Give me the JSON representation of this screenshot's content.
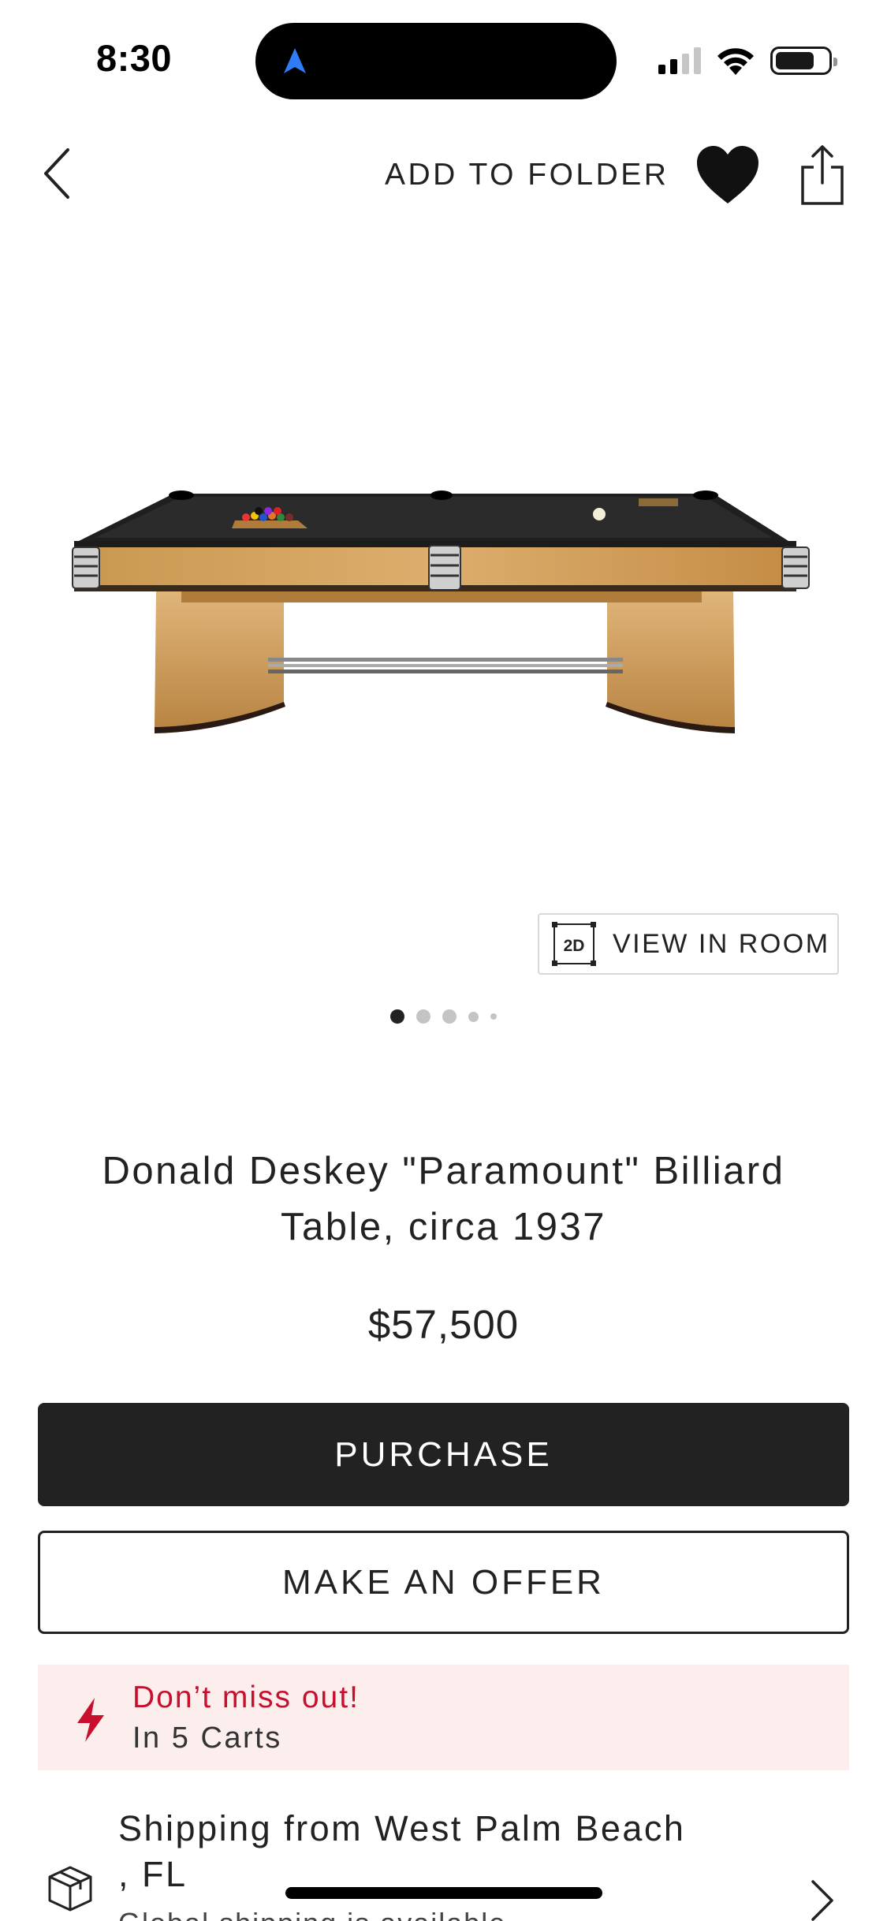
{
  "status_bar": {
    "time": "8:30"
  },
  "nav": {
    "add_to_folder": "ADD TO FOLDER"
  },
  "gallery": {
    "view_in_room_badge": "2D",
    "view_in_room_label": "VIEW IN ROOM",
    "page_count": 5,
    "active_index": 0
  },
  "product": {
    "title": "Donald Deskey \"Paramount\" Billiard Table, circa 1937",
    "price": "$57,500"
  },
  "actions": {
    "purchase_label": "PURCHASE",
    "offer_label": "MAKE AN OFFER"
  },
  "alert": {
    "title": "Don’t miss out!",
    "subtitle": "In 5 Carts",
    "accent_color": "#c8102e"
  },
  "shipping": {
    "title": "Shipping from West Palm Beach , FL",
    "subtitle": "Global shipping is available"
  },
  "icons": {
    "back": "chevron-left-icon",
    "favorite": "heart-icon",
    "share": "share-icon",
    "alert": "lightning-icon",
    "shipping": "package-icon",
    "shipping_chevron": "chevron-right-icon"
  }
}
